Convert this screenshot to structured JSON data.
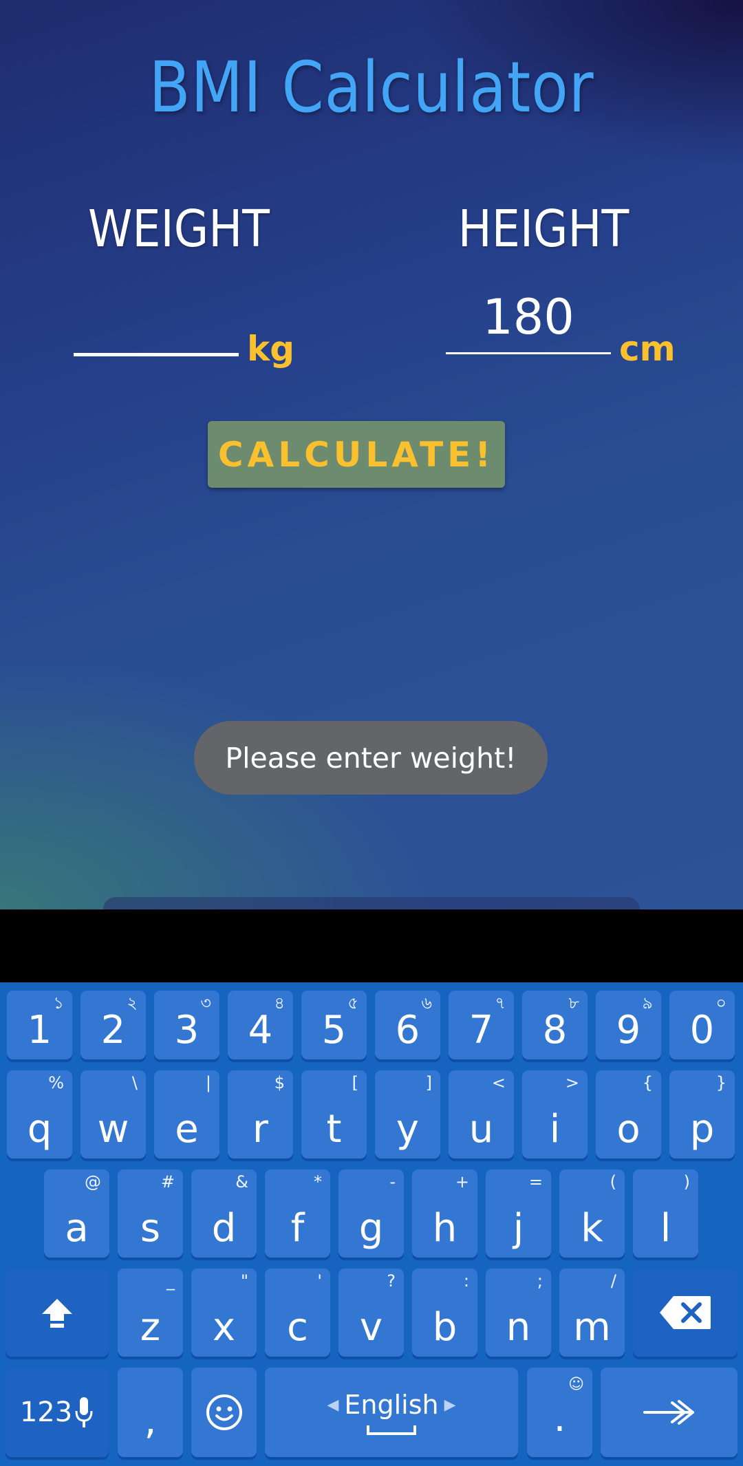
{
  "app": {
    "title": "BMI Calculator",
    "weight_label": "WEIGHT",
    "height_label": "HEIGHT",
    "weight_value": "",
    "height_value": "180",
    "weight_unit": "kg",
    "height_unit": "cm",
    "calculate_label": "CALCULATE!",
    "toast": "Please enter weight!"
  },
  "keyboard": {
    "number_row": [
      {
        "main": "1",
        "hint": "১"
      },
      {
        "main": "2",
        "hint": "২"
      },
      {
        "main": "3",
        "hint": "৩"
      },
      {
        "main": "4",
        "hint": "৪"
      },
      {
        "main": "5",
        "hint": "৫"
      },
      {
        "main": "6",
        "hint": "৬"
      },
      {
        "main": "7",
        "hint": "৭"
      },
      {
        "main": "8",
        "hint": "৮"
      },
      {
        "main": "9",
        "hint": "৯"
      },
      {
        "main": "0",
        "hint": "০"
      }
    ],
    "row1": [
      {
        "main": "q",
        "hint": "%"
      },
      {
        "main": "w",
        "hint": "\\"
      },
      {
        "main": "e",
        "hint": "|"
      },
      {
        "main": "r",
        "hint": "$"
      },
      {
        "main": "t",
        "hint": "["
      },
      {
        "main": "y",
        "hint": "]"
      },
      {
        "main": "u",
        "hint": "<"
      },
      {
        "main": "i",
        "hint": ">"
      },
      {
        "main": "o",
        "hint": "{"
      },
      {
        "main": "p",
        "hint": "}"
      }
    ],
    "row2": [
      {
        "main": "a",
        "hint": "@"
      },
      {
        "main": "s",
        "hint": "#"
      },
      {
        "main": "d",
        "hint": "&"
      },
      {
        "main": "f",
        "hint": "*"
      },
      {
        "main": "g",
        "hint": "-"
      },
      {
        "main": "h",
        "hint": "+"
      },
      {
        "main": "j",
        "hint": "="
      },
      {
        "main": "k",
        "hint": "("
      },
      {
        "main": "l",
        "hint": ")"
      }
    ],
    "row3": [
      {
        "main": "z",
        "hint": "_"
      },
      {
        "main": "x",
        "hint": "\""
      },
      {
        "main": "c",
        "hint": "'"
      },
      {
        "main": "v",
        "hint": "?"
      },
      {
        "main": "b",
        "hint": ":"
      },
      {
        "main": "n",
        "hint": ";"
      },
      {
        "main": "m",
        "hint": "/"
      }
    ],
    "symbols_key": "123",
    "comma_key": ",",
    "space_label": "English",
    "period_key": ".",
    "period_hint": "☺",
    "icons": {
      "shift": "shift-icon",
      "backspace": "backspace-icon",
      "mic": "mic-icon",
      "emoji": "emoji-icon",
      "enter": "enter-arrow-icon"
    }
  }
}
